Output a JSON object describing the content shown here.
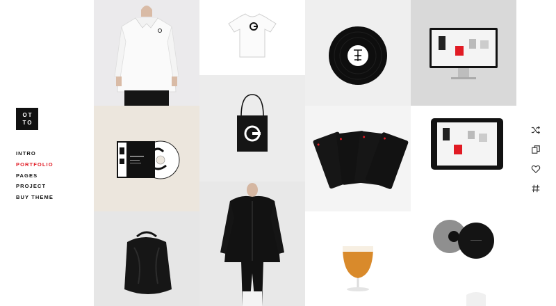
{
  "logo": {
    "line1": "OT",
    "line2": "TO"
  },
  "nav": {
    "items": [
      {
        "label": "INTRO"
      },
      {
        "label": "PORTFOLIO"
      },
      {
        "label": "PAGES"
      },
      {
        "label": "PROJECT"
      },
      {
        "label": "BUY THEME"
      }
    ],
    "active": "PORTFOLIO"
  },
  "tools": [
    "shuffle-icon",
    "copy-icon",
    "heart-icon",
    "hashtag-icon"
  ],
  "portfolio": {
    "items": [
      {
        "name": "white-polo-shirt",
        "image": "white-polo-model-photo"
      },
      {
        "name": "white-tshirt",
        "image": "white-tshirt-with-logo"
      },
      {
        "name": "vinyl-record",
        "image": "black-vinyl-record"
      },
      {
        "name": "desktop-monitor-mockup",
        "image": "monitor-website-mockup"
      },
      {
        "name": "cd-case",
        "image": "cd-packaging"
      },
      {
        "name": "tote-bag",
        "image": "black-tote-bag"
      },
      {
        "name": "playing-cards",
        "image": "black-playing-cards"
      },
      {
        "name": "tablet-mockup",
        "image": "tablet-website-mockup"
      },
      {
        "name": "black-hoodie",
        "image": "black-hoodie-model-photo"
      },
      {
        "name": "black-duffel-bag",
        "image": "black-duffel-bag"
      },
      {
        "name": "beer-glass",
        "image": "beer-glass"
      },
      {
        "name": "coasters",
        "image": "grey-and-black-coasters"
      }
    ]
  }
}
